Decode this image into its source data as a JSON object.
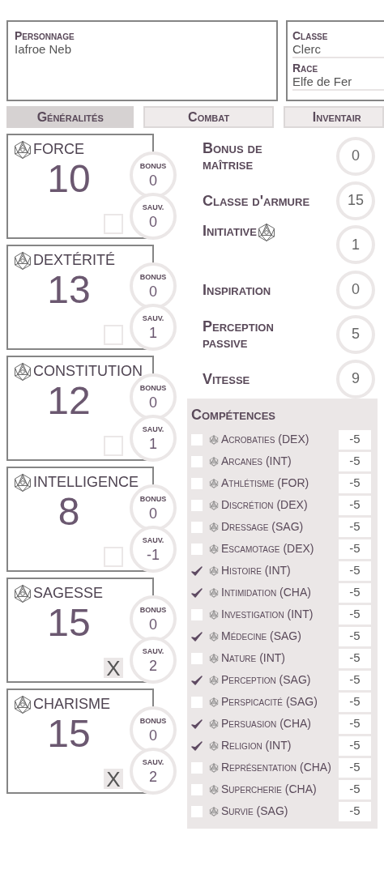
{
  "character": {
    "label": "Personnage",
    "value": "Iafroe Neb"
  },
  "info": [
    {
      "label": "Classe",
      "value": "Clerc"
    },
    {
      "label": "Race",
      "value": "Elfe de Fer"
    }
  ],
  "tabs": [
    {
      "label": "Généralités",
      "selected": true
    },
    {
      "label": "Combat",
      "selected": false
    },
    {
      "label": "Inventair",
      "selected": false
    }
  ],
  "abilities": [
    {
      "name": "FORCE",
      "score": "10",
      "bonus_label": "BONUS",
      "bonus": "0",
      "save_label": "SAUV.",
      "save": "0",
      "save_proficient": false
    },
    {
      "name": "DEXTÉRITÉ",
      "score": "13",
      "bonus_label": "BONUS",
      "bonus": "0",
      "save_label": "SAUV.",
      "save": "1",
      "save_proficient": false
    },
    {
      "name": "CONSTITUTION",
      "score": "12",
      "bonus_label": "BONUS",
      "bonus": "0",
      "save_label": "SAUV.",
      "save": "1",
      "save_proficient": false
    },
    {
      "name": "INTELLIGENCE",
      "score": "8",
      "bonus_label": "BONUS",
      "bonus": "0",
      "save_label": "SAUV.",
      "save": "-1",
      "save_proficient": false
    },
    {
      "name": "SAGESSE",
      "score": "15",
      "bonus_label": "BONUS",
      "bonus": "0",
      "save_label": "SAUV.",
      "save": "2",
      "save_proficient": true,
      "save_mark": "X"
    },
    {
      "name": "CHARISME",
      "score": "15",
      "bonus_label": "BONUS",
      "bonus": "0",
      "save_label": "SAUV.",
      "save": "2",
      "save_proficient": true,
      "save_mark": "X"
    }
  ],
  "stats": [
    {
      "label": "Bonus de maîtrise",
      "value": "0",
      "has_die": false
    },
    {
      "label": "Classe d'armure",
      "value": "15",
      "has_die": false
    },
    {
      "label": "Initiative",
      "value": "1",
      "has_die": true
    },
    {
      "label": "Inspiration",
      "value": "0",
      "has_die": false
    },
    {
      "label": "Perception passive",
      "value": "5",
      "has_die": false
    },
    {
      "label": "Vitesse",
      "value": "9",
      "has_die": false
    }
  ],
  "skills": {
    "title": "Compétences",
    "items": [
      {
        "name": "Acrobaties (DEX)",
        "value": "-5",
        "proficient": false
      },
      {
        "name": "Arcanes (INT)",
        "value": "-5",
        "proficient": false
      },
      {
        "name": "Athlétisme (FOR)",
        "value": "-5",
        "proficient": false
      },
      {
        "name": "Discrétion (DEX)",
        "value": "-5",
        "proficient": false
      },
      {
        "name": "Dressage (SAG)",
        "value": "-5",
        "proficient": false
      },
      {
        "name": "Escamotage (DEX)",
        "value": "-5",
        "proficient": false
      },
      {
        "name": "Histoire (INT)",
        "value": "-5",
        "proficient": true
      },
      {
        "name": "Intimidation (CHA)",
        "value": "-5",
        "proficient": true
      },
      {
        "name": "Investigation (INT)",
        "value": "-5",
        "proficient": false
      },
      {
        "name": "Médecine (SAG)",
        "value": "-5",
        "proficient": true
      },
      {
        "name": "Nature (INT)",
        "value": "-5",
        "proficient": false
      },
      {
        "name": "Perception (SAG)",
        "value": "-5",
        "proficient": true
      },
      {
        "name": "Perspicacité (SAG)",
        "value": "-5",
        "proficient": false
      },
      {
        "name": "Persuasion (CHA)",
        "value": "-5",
        "proficient": true
      },
      {
        "name": "Religion (INT)",
        "value": "-5",
        "proficient": true
      },
      {
        "name": "Représentation (CHA)",
        "value": "-5",
        "proficient": false
      },
      {
        "name": "Supercherie (CHA)",
        "value": "-5",
        "proficient": false
      },
      {
        "name": "Survie (SAG)",
        "value": "-5",
        "proficient": false
      }
    ]
  }
}
